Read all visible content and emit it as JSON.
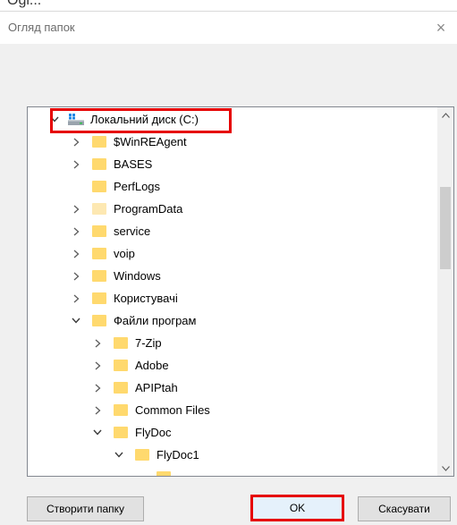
{
  "top_strip_text": "Ogl...",
  "window": {
    "title": "Огляд папок",
    "close_glyph": "×"
  },
  "tree": {
    "items": [
      {
        "label": "Локальний диск (C:)",
        "level": 0,
        "expander": "expanded",
        "icon": "drive-icon"
      },
      {
        "label": "$WinREAgent",
        "level": 1,
        "expander": "collapsed",
        "icon": "folder-icon"
      },
      {
        "label": "BASES",
        "level": 1,
        "expander": "collapsed",
        "icon": "folder-icon"
      },
      {
        "label": "PerfLogs",
        "level": 1,
        "expander": "none",
        "icon": "folder-icon"
      },
      {
        "label": "ProgramData",
        "level": 1,
        "expander": "collapsed",
        "icon": "folder-icon",
        "pale": true
      },
      {
        "label": "service",
        "level": 1,
        "expander": "collapsed",
        "icon": "folder-icon"
      },
      {
        "label": "voip",
        "level": 1,
        "expander": "collapsed",
        "icon": "folder-icon"
      },
      {
        "label": "Windows",
        "level": 1,
        "expander": "collapsed",
        "icon": "folder-icon"
      },
      {
        "label": "Користувачі",
        "level": 1,
        "expander": "collapsed",
        "icon": "folder-icon"
      },
      {
        "label": "Файли програм",
        "level": 1,
        "expander": "expanded",
        "icon": "folder-icon"
      },
      {
        "label": "7-Zip",
        "level": 2,
        "expander": "collapsed",
        "icon": "folder-icon"
      },
      {
        "label": "Adobe",
        "level": 2,
        "expander": "collapsed",
        "icon": "folder-icon"
      },
      {
        "label": "APIPtah",
        "level": 2,
        "expander": "collapsed",
        "icon": "folder-icon"
      },
      {
        "label": "Common Files",
        "level": 2,
        "expander": "collapsed",
        "icon": "folder-icon"
      },
      {
        "label": "FlyDoc",
        "level": 2,
        "expander": "expanded",
        "icon": "folder-icon"
      },
      {
        "label": "FlyDoc1",
        "level": 3,
        "expander": "expanded",
        "icon": "folder-icon"
      },
      {
        "label": "",
        "level": 4,
        "expander": "none",
        "icon": "folder-icon"
      }
    ]
  },
  "buttons": {
    "new_folder": "Створити папку",
    "ok": "OK",
    "cancel": "Скасувати"
  },
  "colors": {
    "highlight_box": "#e60000",
    "folder": "#ffd96e"
  }
}
